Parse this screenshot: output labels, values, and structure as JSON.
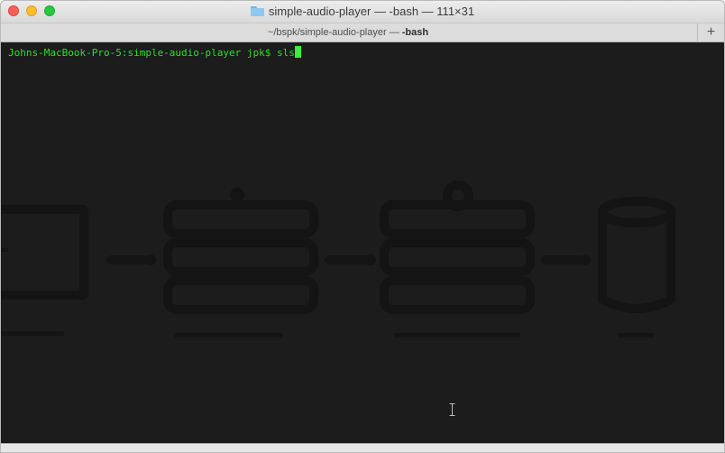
{
  "window": {
    "title_folder": "simple-audio-player",
    "title_rest": " — -bash — 111×31"
  },
  "tab": {
    "path": "~/bspk/simple-audio-player — ",
    "process": "-bash",
    "new_tab_label": "+"
  },
  "terminal": {
    "prompt": "Johns-MacBook-Pro-5:simple-audio-player jpk$ ",
    "command": "sls"
  },
  "colors": {
    "terminal_bg": "#1c1c1c",
    "prompt_green": "#32dc32",
    "cursor": "#3bef3b",
    "diagram_dark": "#141414"
  }
}
